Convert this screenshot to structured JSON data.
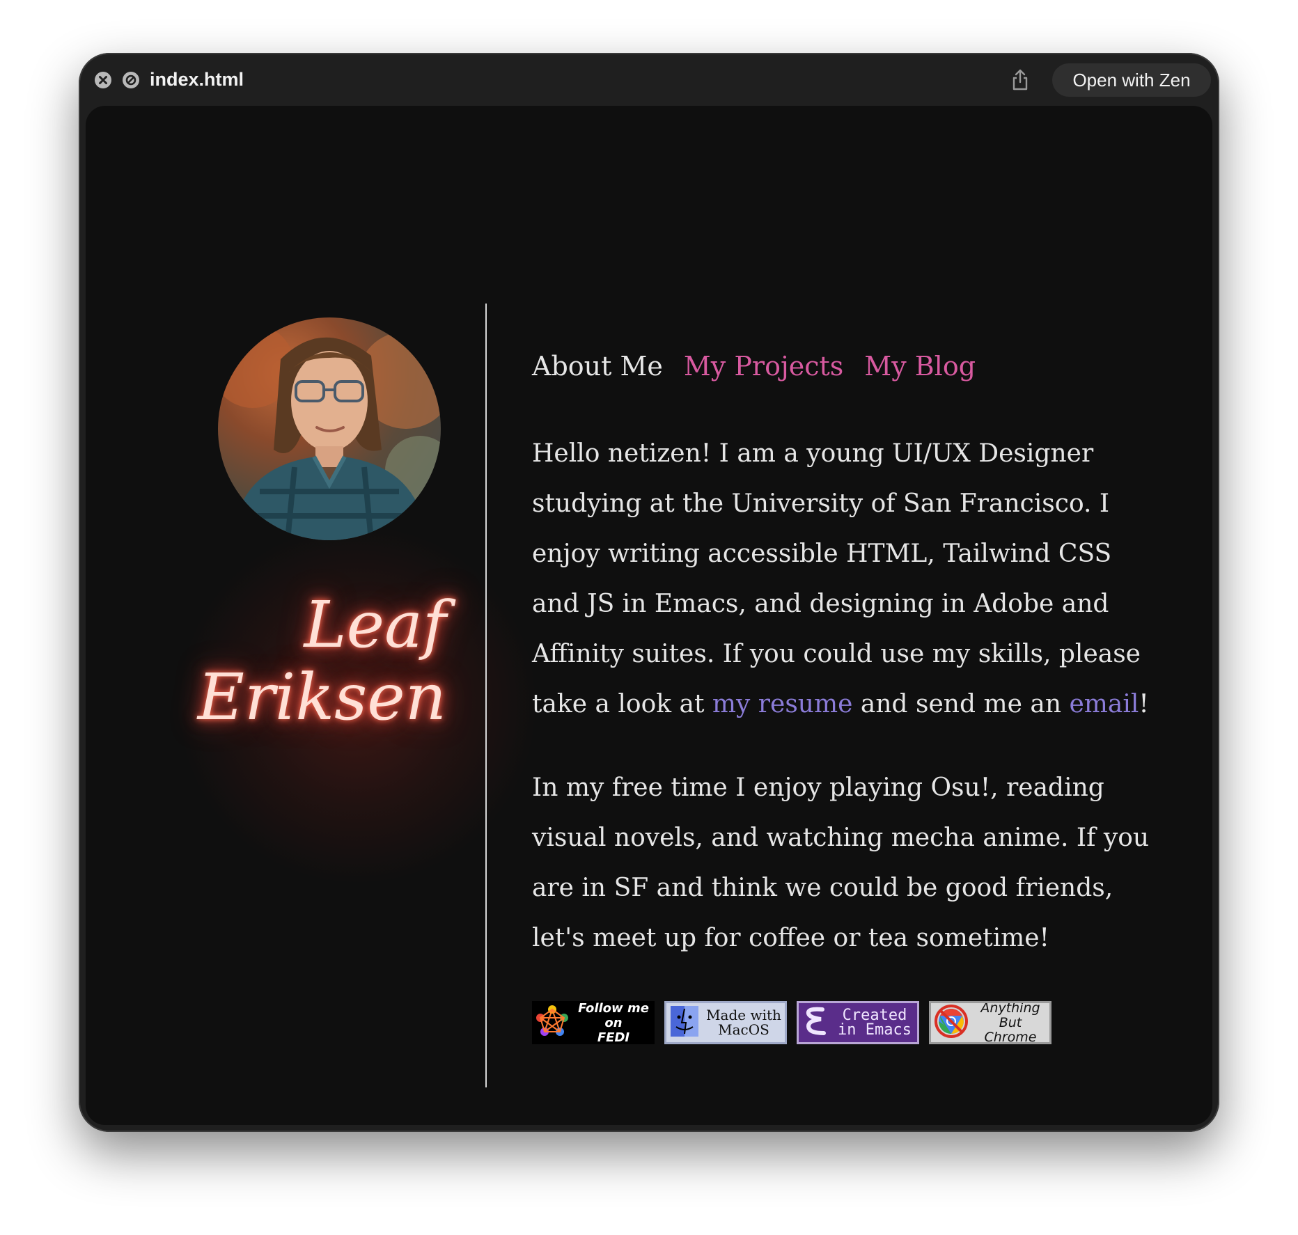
{
  "window": {
    "title": "index.html",
    "open_button": "Open with Zen",
    "icons": [
      "close-icon",
      "block-icon",
      "share-icon"
    ]
  },
  "profile": {
    "first_name": "Leaf",
    "last_name": "Eriksen"
  },
  "nav": {
    "about": "About Me",
    "projects": "My Projects",
    "blog": "My Blog"
  },
  "about": {
    "p1_text": "Hello netizen! I am a young UI/UX Designer studying at the University of San Francisco. I enjoy writing accessible HTML, Tailwind CSS and JS in Emacs, and designing in Adobe and Affinity suites. If you could use my skills, please take a look at ",
    "resume_link": "my resume",
    "p1_mid": " and send me an ",
    "email_link": "email",
    "p1_end": "!",
    "p2_text": "In my free time I enjoy playing Osu!, reading visual novels, and watching mecha anime. If you are in SF and think we could be good friends, let's meet up for coffee or tea sometime!"
  },
  "badges": {
    "fedi": "Follow me on\nFEDI",
    "macos": "Made with\nMacOS",
    "emacs": "Created\nin Emacs",
    "chrome": "Anything\nBut Chrome"
  },
  "colors": {
    "nav_link": "#d85aa0",
    "inline_link": "#8b7cd8",
    "text": "#e6e6e6",
    "background": "#0f0f0f",
    "name_glow": "#e0483a"
  }
}
